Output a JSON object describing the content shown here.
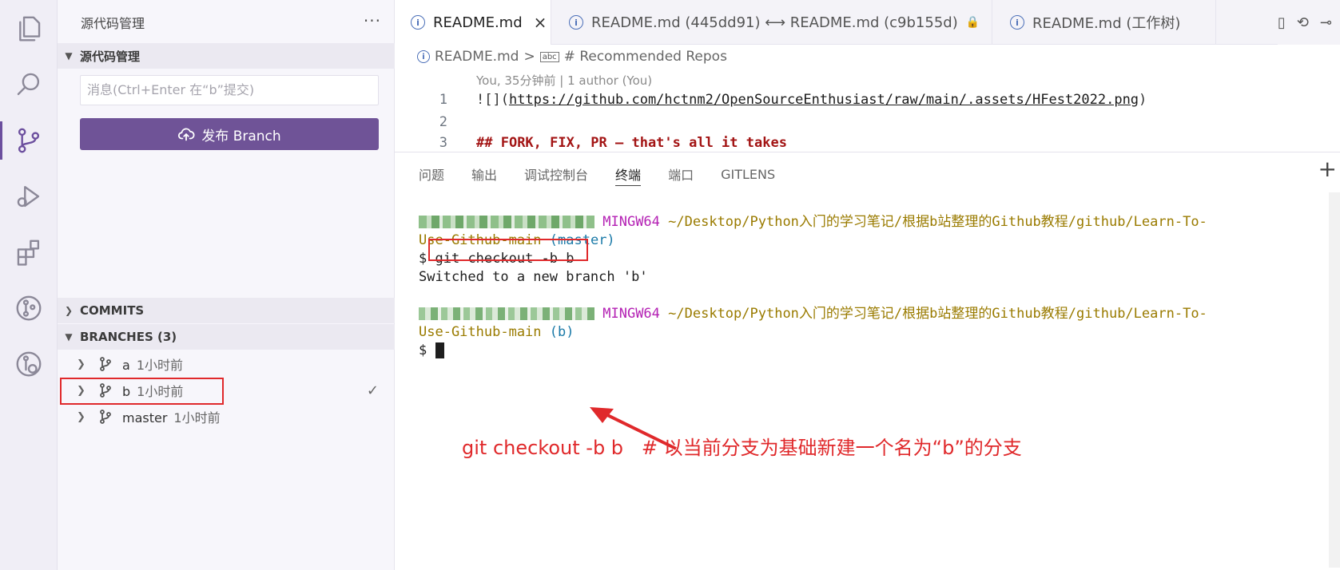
{
  "sidebar": {
    "title": "源代码管理",
    "more": "···",
    "section_title": "源代码管理",
    "commit_placeholder": "消息(Ctrl+Enter 在“b”提交)",
    "publish_label": "发布 Branch",
    "commits_title": "COMMITS",
    "branches_title": "BRANCHES (3)",
    "branches": [
      {
        "name": "a",
        "time": "1小时前"
      },
      {
        "name": "b",
        "time": "1小时前",
        "current_check": "✓"
      },
      {
        "name": "master",
        "time": "1小时前"
      }
    ]
  },
  "tabs": [
    {
      "label": "README.md",
      "close": "×"
    },
    {
      "label": "README.md (445dd91) ⟷ README.md (c9b155d)"
    },
    {
      "label": "README.md (工作树)"
    }
  ],
  "breadcrumb": {
    "file": "README.md",
    "separator": ">",
    "symbol_glyph": "abc",
    "symbol": "# Recommended Repos"
  },
  "codelens": "You, 35分钟前 | 1 author (You)",
  "code_lines": [
    {
      "num": "1",
      "prefix": "![](",
      "link": "https://github.com/hctnm2/OpenSourceEnthusiast/raw/main/.assets/HFest2022.png",
      "suffix": ")"
    },
    {
      "num": "2",
      "text": ""
    },
    {
      "num": "3",
      "prefix": "## ",
      "heading": "FORK, FIX, PR — that's all it takes"
    }
  ],
  "panel": {
    "tabs": [
      "问题",
      "输出",
      "调试控制台",
      "终端",
      "端口",
      "GITLENS"
    ],
    "active_tab": "终端",
    "plus": "+"
  },
  "terminal": {
    "env": "MINGW64",
    "path_line1": "~/Desktop/Python入门的学习笔记/根据b站整理的Github教程/github/Learn-To-",
    "path_line2": "Use-Github-main",
    "branch1": "(master)",
    "prompt": "$",
    "command": "git checkout -b b",
    "output": "Switched to a new branch 'b'",
    "branch2": "(b)"
  },
  "annotation": "git checkout -b b   # 以当前分支为基础新建一个名为“b”的分支",
  "colors": {
    "accent": "#6f5397",
    "annotation_red": "#e0292b",
    "terminal_magenta": "#b421b4",
    "terminal_path": "#9a7b00",
    "terminal_branch": "#1b7aa8"
  }
}
